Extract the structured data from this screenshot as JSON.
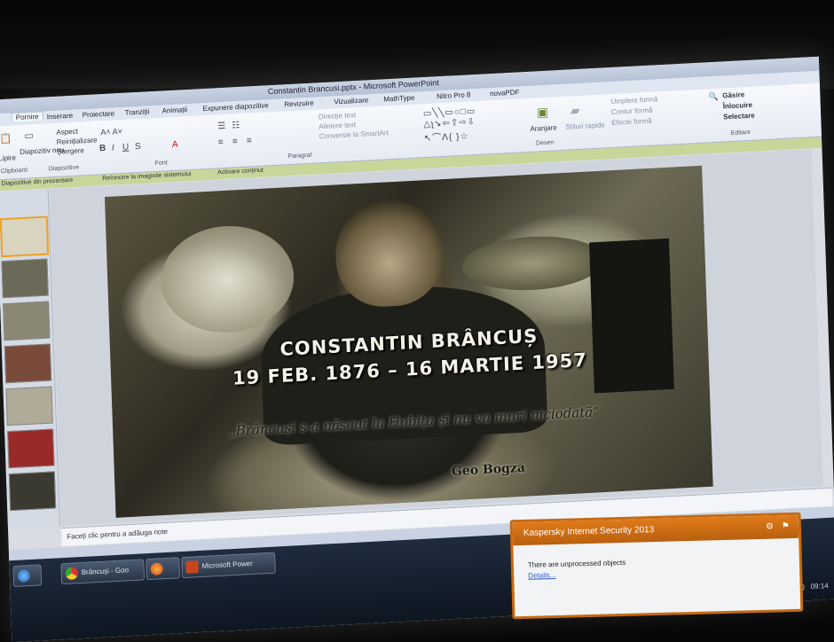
{
  "window": {
    "title": "Constantin Brancusi.pptx - Microsoft PowerPoint"
  },
  "ribbon_tabs": [
    {
      "label": "Pornire"
    },
    {
      "label": "Inserare"
    },
    {
      "label": "Proiectare"
    },
    {
      "label": "Tranziții"
    },
    {
      "label": "Animații"
    },
    {
      "label": "Expunere diapozitive"
    },
    {
      "label": "Revizuire"
    },
    {
      "label": "Vizualizare"
    },
    {
      "label": "MathType"
    },
    {
      "label": "Nitro Pro 8"
    },
    {
      "label": "novaPDF"
    }
  ],
  "ribbon": {
    "paste_label": "Lipire",
    "new_slide_label": "Diapozitiv nou",
    "layout_label": "Aspect",
    "reset_label": "Reinițializare",
    "delete_label": "Ștergere",
    "group_clipboard": "Clipboard",
    "group_slides": "Diapozitive",
    "group_font": "Font",
    "group_paragraph": "Paragraf",
    "text_direction_label": "Direcție text",
    "align_text_label": "Aliniere text",
    "smartart_label": "Conversie la SmartArt",
    "group_drawing": "Desen",
    "arrange_label": "Aranjare",
    "quick_styles_label": "Stiluri rapide",
    "shape_fill_label": "Umplere formă",
    "shape_outline_label": "Contur formă",
    "shape_effects_label": "Efecte formă",
    "find_label": "Găsire",
    "replace_label": "Înlocuire",
    "select_label": "Selectare",
    "group_editing": "Editare"
  },
  "notification_bar": {
    "text": "Diapozitive din prezentare",
    "action1": "Reînnoire la imaginile sistemului",
    "action2": "Activare conținut"
  },
  "slide": {
    "title_line1": "CONSTANTIN BRÂNCUȘ",
    "title_line2": "19 FEB. 1876 – 16 MARTIE 1957",
    "quote": "„Brâncuși s-a născut la Hobița și nu va muri niciodată”",
    "author": "Geo Bogza"
  },
  "notes_placeholder": "Faceți clic pentru a adăuga note",
  "taskbar": {
    "items": [
      {
        "label": "Brâncuși - Goo"
      },
      {
        "label": ""
      },
      {
        "label": "Microsoft Power"
      }
    ],
    "language": "RO",
    "clock": "09:14"
  },
  "kaspersky": {
    "title": "Kaspersky Internet Security 2013",
    "message": "There are unprocessed objects",
    "link": "Details..."
  },
  "colors": {
    "kaspersky_orange": "#d9731a",
    "ribbon_bg": "#eef2f8",
    "notif_green": "#c7d79a"
  }
}
